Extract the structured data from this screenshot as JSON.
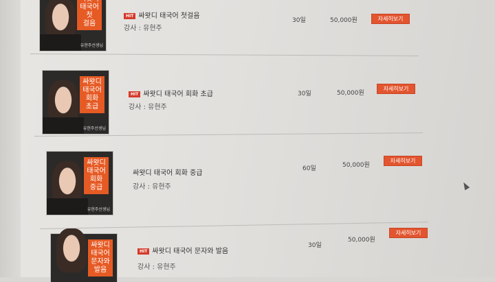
{
  "courses": [
    {
      "badge": "HIT",
      "title": "싸왓디 태국어 첫걸음",
      "teacher": "강사 : 유현주",
      "duration": "30일",
      "price": "50,000원",
      "detail_label": "자세히보기",
      "thumb_tag": "싸왓디\n태국어\n첫\n걸음",
      "thumb_caption": "유현주선생님"
    },
    {
      "badge": "HIT",
      "title": "싸왓디 태국어 회화 초급",
      "teacher": "강사 : 유현주",
      "duration": "30일",
      "price": "50,000원",
      "detail_label": "자세히보기",
      "thumb_tag": "싸왓디\n태국어\n회화\n초급",
      "thumb_caption": "유현주선생님"
    },
    {
      "badge": "",
      "title": "싸왓디 태국어 회화 중급",
      "teacher": "강사 : 유현주",
      "duration": "60일",
      "price": "50,000원",
      "detail_label": "자세히보기",
      "thumb_tag": "싸왓디\n태국어\n회화\n중급",
      "thumb_caption": "유현주선생님"
    },
    {
      "badge": "HIT",
      "title": "싸왓디 태국어 문자와 발음",
      "teacher": "강사 : 유현주",
      "duration": "30일",
      "price": "50,000원",
      "detail_label": "자세히보기",
      "thumb_tag": "싸왓디\n태국어\n문자와\n발음",
      "thumb_caption": ""
    }
  ],
  "colors": {
    "accent": "#e2552f",
    "hit_badge": "#d63a2a",
    "thumb_tag": "#e65a24"
  }
}
